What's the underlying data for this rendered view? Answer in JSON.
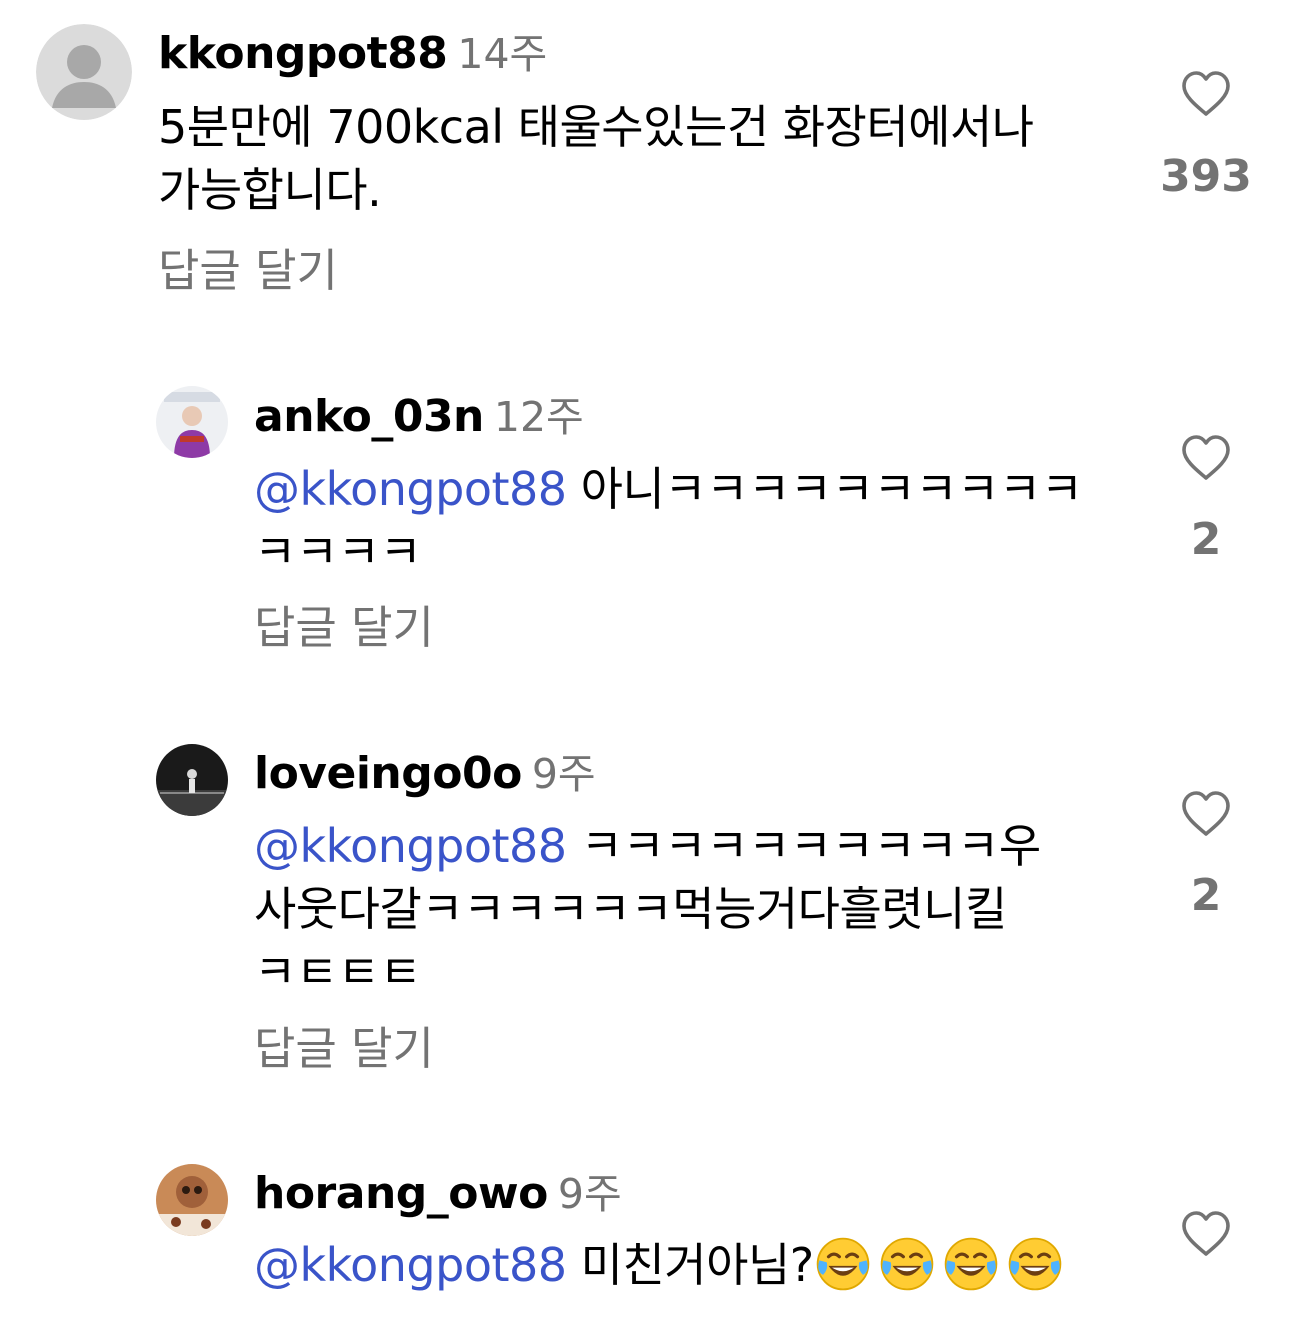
{
  "colors": {
    "mention": "#3a54c9",
    "secondary_text": "#737373",
    "default_avatar_bg": "#dbdbdb",
    "default_avatar_fg": "#a8a8a8"
  },
  "comments": [
    {
      "username": "kkongpot88",
      "time": "14주",
      "text_lines": [
        "5분만에 700kcal 태울수있는건 화장터에서나",
        "가능합니다."
      ],
      "reply_label": "답글 달기",
      "likes": "393",
      "avatar_icon": "default-avatar-icon"
    },
    {
      "username": "anko_03n",
      "time": "12주",
      "mention": "@kkongpot88",
      "text_lines": [
        " 아니ㅋㅋㅋㅋㅋㅋㅋㅋㅋㅋ",
        "ㅋㅋㅋㅋ"
      ],
      "reply_label": "답글 달기",
      "likes": "2"
    },
    {
      "username": "loveingo0o",
      "time": "9주",
      "mention": "@kkongpot88",
      "text_lines": [
        " ㅋㅋㅋㅋㅋㅋㅋㅋㅋㅋ우",
        "사웃다갈ㅋㅋㅋㅋㅋㅋ먹능거다흘렷니킬",
        "ㅋㅌㅌㅌ"
      ],
      "reply_label": "답글 달기",
      "likes": "2"
    },
    {
      "username": "horang_owo",
      "time": "9주",
      "mention": "@kkongpot88",
      "text_lines": [
        " 미친거아님?"
      ],
      "emoji": "face-with-tears-of-joy-icon",
      "emoji_count": 4
    }
  ]
}
